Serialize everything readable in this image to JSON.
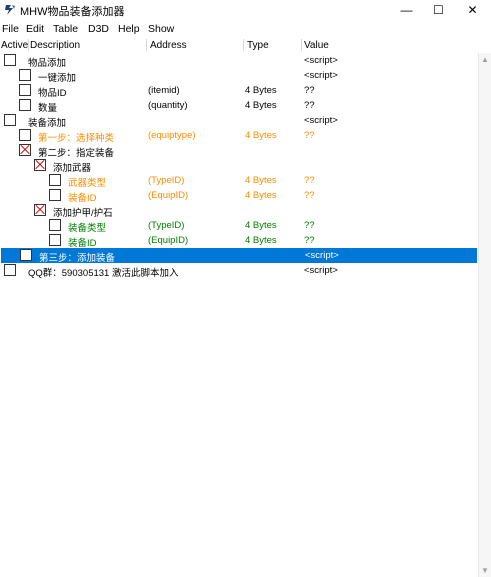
{
  "window": {
    "title": "MHW物品装备添加器",
    "icon": "cheat-engine-crab-icon",
    "minimize_glyph": "—",
    "maximize_glyph": "☐",
    "close_glyph": "✕"
  },
  "menu": [
    "File",
    "Edit",
    "Table",
    "D3D",
    "Help",
    "Show"
  ],
  "columns": {
    "active": "Active",
    "description": "Description",
    "address": "Address",
    "type": "Type",
    "value": "Value"
  },
  "colors": {
    "orange": "#ff8c00",
    "green": "#008000",
    "selection": "#0078d7"
  },
  "rows": [
    {
      "description": "物品添加",
      "address": "",
      "type": "",
      "value": "<script>",
      "checked": false,
      "color": "black",
      "selected": false
    },
    {
      "description": "一键添加",
      "address": "",
      "type": "",
      "value": "<script>",
      "checked": false,
      "color": "black",
      "selected": false
    },
    {
      "description": "物品ID",
      "address": "(itemid)",
      "type": "4 Bytes",
      "value": "??",
      "checked": false,
      "color": "black",
      "selected": false
    },
    {
      "description": "数量",
      "address": "(quantity)",
      "type": "4 Bytes",
      "value": "??",
      "checked": false,
      "color": "black",
      "selected": false
    },
    {
      "description": "装备添加",
      "address": "",
      "type": "",
      "value": "<script>",
      "checked": false,
      "color": "black",
      "selected": false
    },
    {
      "description": "第一步：选择种类",
      "address": "(equiptype)",
      "type": "4 Bytes",
      "value": "??",
      "checked": false,
      "color": "orange",
      "selected": false
    },
    {
      "description": "第二步：指定装备",
      "address": "",
      "type": "",
      "value": "",
      "checked": true,
      "color": "black",
      "selected": false
    },
    {
      "description": "添加武器",
      "address": "",
      "type": "",
      "value": "",
      "checked": true,
      "color": "black",
      "selected": false
    },
    {
      "description": "武器类型",
      "address": "(TypeID)",
      "type": "4 Bytes",
      "value": "??",
      "checked": false,
      "color": "orange",
      "selected": false
    },
    {
      "description": "装备ID",
      "address": "(EquipID)",
      "type": "4 Bytes",
      "value": "??",
      "checked": false,
      "color": "orange",
      "selected": false
    },
    {
      "description": "添加护甲/护石",
      "address": "",
      "type": "",
      "value": "",
      "checked": true,
      "color": "black",
      "selected": false
    },
    {
      "description": "装备类型",
      "address": "(TypeID)",
      "type": "4 Bytes",
      "value": "??",
      "checked": false,
      "color": "green",
      "selected": false
    },
    {
      "description": "装备ID",
      "address": "(EquipID)",
      "type": "4 Bytes",
      "value": "??",
      "checked": false,
      "color": "green",
      "selected": false
    },
    {
      "description": "第三步：添加装备",
      "address": "",
      "type": "",
      "value": "<script>",
      "checked": false,
      "color": "black",
      "selected": true
    },
    {
      "description": "QQ群：590305131 激活此脚本加入",
      "address": "",
      "type": "",
      "value": "<script>",
      "checked": false,
      "color": "black",
      "selected": false
    }
  ]
}
